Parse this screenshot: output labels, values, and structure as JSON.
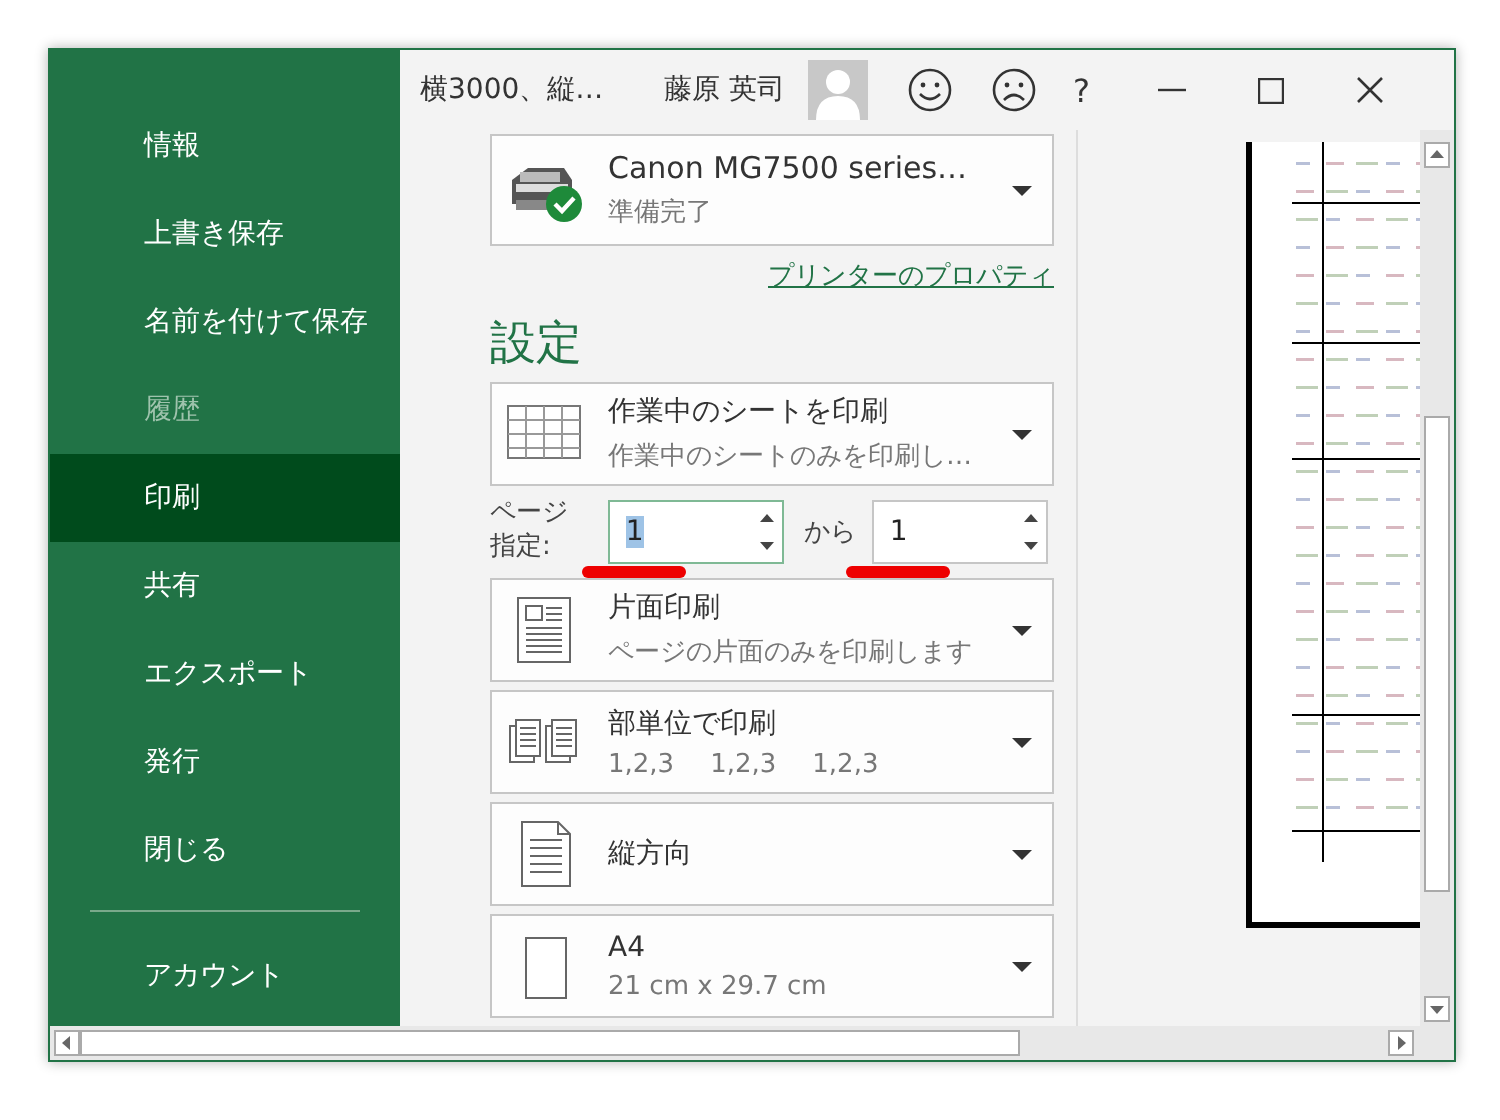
{
  "window": {
    "title": "横3000、縦…",
    "user_name": "藤原 英司",
    "help": "?"
  },
  "sidebar": {
    "items": [
      {
        "label": "情報",
        "selected": false,
        "disabled": false
      },
      {
        "label": "上書き保存",
        "selected": false,
        "disabled": false
      },
      {
        "label": "名前を付けて保存",
        "selected": false,
        "disabled": false
      },
      {
        "label": "履歴",
        "selected": false,
        "disabled": true
      },
      {
        "label": "印刷",
        "selected": true,
        "disabled": false
      },
      {
        "label": "共有",
        "selected": false,
        "disabled": false
      },
      {
        "label": "エクスポート",
        "selected": false,
        "disabled": false
      },
      {
        "label": "発行",
        "selected": false,
        "disabled": false
      },
      {
        "label": "閉じる",
        "selected": false,
        "disabled": false
      }
    ],
    "bottom_items": [
      {
        "label": "アカウント",
        "selected": false,
        "disabled": false
      }
    ]
  },
  "printer": {
    "name": "Canon MG7500 series…",
    "status": "準備完了",
    "properties_link": "プリンターのプロパティ"
  },
  "settings": {
    "heading": "設定",
    "options": [
      {
        "kind": "sheet",
        "title": "作業中のシートを印刷",
        "subtitle": "作業中のシートのみを印刷し…"
      },
      {
        "kind": "sides",
        "title": "片面印刷",
        "subtitle": "ページの片面のみを印刷します"
      },
      {
        "kind": "collate",
        "title": "部単位で印刷",
        "subtitle_parts": [
          "1,2,3",
          "1,2,3",
          "1,2,3"
        ]
      },
      {
        "kind": "orientation",
        "title": "縦方向"
      },
      {
        "kind": "paper",
        "title": "A4",
        "subtitle": "21 cm x 29.7 cm"
      }
    ],
    "pages": {
      "label": "ページ指定:",
      "from": {
        "value": "1",
        "text_selected": true
      },
      "to_label": "から",
      "to": {
        "value": "1",
        "text_selected": false
      }
    }
  }
}
